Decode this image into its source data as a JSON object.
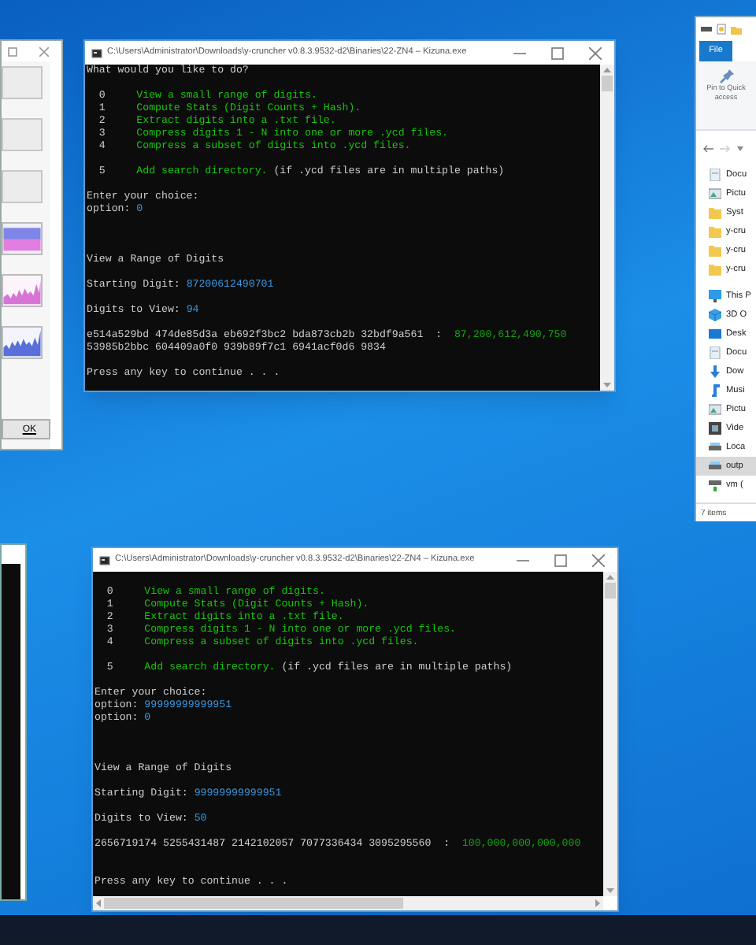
{
  "left_window": {
    "ok_button": "OK"
  },
  "consoles": [
    {
      "title": "C:\\Users\\Administrator\\Downloads\\y-cruncher v0.8.3.9532-d2\\Binaries\\22-ZN4 – Kizuna.exe",
      "horizontal_scrollbar": false,
      "lines": [
        {
          "kind": "text",
          "segments": [
            {
              "kind": "prompt",
              "text": "What would you like to do?"
            }
          ]
        },
        {
          "kind": "blank"
        },
        {
          "kind": "text",
          "segments": [
            {
              "kind": "prompt",
              "text": "  0     "
            },
            {
              "kind": "menu",
              "text": "View a small range of digits."
            }
          ]
        },
        {
          "kind": "text",
          "segments": [
            {
              "kind": "prompt",
              "text": "  1     "
            },
            {
              "kind": "menu",
              "text": "Compute Stats (Digit Counts + Hash)."
            }
          ]
        },
        {
          "kind": "text",
          "segments": [
            {
              "kind": "prompt",
              "text": "  2     "
            },
            {
              "kind": "menu",
              "text": "Extract digits into a .txt file."
            }
          ]
        },
        {
          "kind": "text",
          "segments": [
            {
              "kind": "prompt",
              "text": "  3     "
            },
            {
              "kind": "menu",
              "text": "Compress digits 1 - N into one or more .ycd files."
            }
          ]
        },
        {
          "kind": "text",
          "segments": [
            {
              "kind": "prompt",
              "text": "  4     "
            },
            {
              "kind": "menu",
              "text": "Compress a subset of digits into .ycd files."
            }
          ]
        },
        {
          "kind": "blank"
        },
        {
          "kind": "text",
          "segments": [
            {
              "kind": "prompt",
              "text": "  5     "
            },
            {
              "kind": "menu",
              "text": "Add search directory."
            },
            {
              "kind": "prompt",
              "text": " (if .ycd files are in multiple paths)"
            }
          ]
        },
        {
          "kind": "blank"
        },
        {
          "kind": "text",
          "segments": [
            {
              "kind": "prompt",
              "text": "Enter your choice:"
            }
          ]
        },
        {
          "kind": "text",
          "segments": [
            {
              "kind": "prompt",
              "text": "option: "
            },
            {
              "kind": "input",
              "text": "0"
            }
          ]
        },
        {
          "kind": "blank"
        },
        {
          "kind": "blank"
        },
        {
          "kind": "blank"
        },
        {
          "kind": "text",
          "segments": [
            {
              "kind": "prompt",
              "text": "View a Range of Digits"
            }
          ]
        },
        {
          "kind": "blank"
        },
        {
          "kind": "text",
          "segments": [
            {
              "kind": "prompt",
              "text": "Starting Digit: "
            },
            {
              "kind": "input",
              "text": "87200612490701"
            }
          ]
        },
        {
          "kind": "blank"
        },
        {
          "kind": "text",
          "segments": [
            {
              "kind": "prompt",
              "text": "Digits to View: "
            },
            {
              "kind": "input",
              "text": "94"
            }
          ]
        },
        {
          "kind": "blank"
        },
        {
          "kind": "text",
          "segments": [
            {
              "kind": "prompt",
              "text": "e514a529bd 474de85d3a eb692f3bc2 bda873cb2b 32bdf9a561  :  "
            },
            {
              "kind": "total",
              "text": "87,200,612,490,750"
            }
          ]
        },
        {
          "kind": "text",
          "segments": [
            {
              "kind": "prompt",
              "text": "53985b2bbc 604409a0f0 939b89f7c1 6941acf0d6 9834"
            }
          ]
        },
        {
          "kind": "blank"
        },
        {
          "kind": "text",
          "segments": [
            {
              "kind": "prompt",
              "text": "Press any key to continue . . ."
            }
          ]
        }
      ]
    },
    {
      "title": "C:\\Users\\Administrator\\Downloads\\y-cruncher v0.8.3.9532-d2\\Binaries\\22-ZN4 – Kizuna.exe",
      "horizontal_scrollbar": true,
      "lines": [
        {
          "kind": "text",
          "segments": [
            {
              "kind": "prompt",
              "text": "  0     "
            },
            {
              "kind": "menu",
              "text": "View a small range of digits."
            }
          ]
        },
        {
          "kind": "text",
          "segments": [
            {
              "kind": "prompt",
              "text": "  1     "
            },
            {
              "kind": "menu",
              "text": "Compute Stats (Digit Counts + Hash)."
            }
          ]
        },
        {
          "kind": "text",
          "segments": [
            {
              "kind": "prompt",
              "text": "  2     "
            },
            {
              "kind": "menu",
              "text": "Extract digits into a .txt file."
            }
          ]
        },
        {
          "kind": "text",
          "segments": [
            {
              "kind": "prompt",
              "text": "  3     "
            },
            {
              "kind": "menu",
              "text": "Compress digits 1 - N into one or more .ycd files."
            }
          ]
        },
        {
          "kind": "text",
          "segments": [
            {
              "kind": "prompt",
              "text": "  4     "
            },
            {
              "kind": "menu",
              "text": "Compress a subset of digits into .ycd files."
            }
          ]
        },
        {
          "kind": "blank"
        },
        {
          "kind": "text",
          "segments": [
            {
              "kind": "prompt",
              "text": "  5     "
            },
            {
              "kind": "menu",
              "text": "Add search directory."
            },
            {
              "kind": "prompt",
              "text": " (if .ycd files are in multiple paths)"
            }
          ]
        },
        {
          "kind": "blank"
        },
        {
          "kind": "text",
          "segments": [
            {
              "kind": "prompt",
              "text": "Enter your choice:"
            }
          ]
        },
        {
          "kind": "text",
          "segments": [
            {
              "kind": "prompt",
              "text": "option: "
            },
            {
              "kind": "input",
              "text": "99999999999951"
            }
          ]
        },
        {
          "kind": "text",
          "segments": [
            {
              "kind": "prompt",
              "text": "option: "
            },
            {
              "kind": "input",
              "text": "0"
            }
          ]
        },
        {
          "kind": "blank"
        },
        {
          "kind": "blank"
        },
        {
          "kind": "blank"
        },
        {
          "kind": "text",
          "segments": [
            {
              "kind": "prompt",
              "text": "View a Range of Digits"
            }
          ]
        },
        {
          "kind": "blank"
        },
        {
          "kind": "text",
          "segments": [
            {
              "kind": "prompt",
              "text": "Starting Digit: "
            },
            {
              "kind": "input",
              "text": "99999999999951"
            }
          ]
        },
        {
          "kind": "blank"
        },
        {
          "kind": "text",
          "segments": [
            {
              "kind": "prompt",
              "text": "Digits to View: "
            },
            {
              "kind": "input",
              "text": "50"
            }
          ]
        },
        {
          "kind": "blank"
        },
        {
          "kind": "text",
          "segments": [
            {
              "kind": "prompt",
              "text": "2656719174 5255431487 2142102057 7077336434 3095295560  :  "
            },
            {
              "kind": "total",
              "text": "100,000,000,000,000"
            }
          ]
        },
        {
          "kind": "blank"
        },
        {
          "kind": "blank"
        },
        {
          "kind": "text",
          "segments": [
            {
              "kind": "prompt",
              "text": "Press any key to continue . . ."
            }
          ]
        }
      ]
    }
  ],
  "explorer": {
    "file_tab": "File",
    "pin_label": "Pin to Quick access",
    "nav_items": [
      {
        "label": "Docu",
        "kind": "document",
        "selected": false
      },
      {
        "label": "Pictu",
        "kind": "pictures",
        "selected": false
      },
      {
        "label": "Syst",
        "kind": "folder",
        "selected": false
      },
      {
        "label": "y-cru",
        "kind": "folder",
        "selected": false
      },
      {
        "label": "y-cru",
        "kind": "folder",
        "selected": false
      },
      {
        "label": "y-cru",
        "kind": "folder",
        "selected": false
      },
      {
        "label": "This P",
        "kind": "computer",
        "selected": false
      },
      {
        "label": "3D O",
        "kind": "cube",
        "selected": false
      },
      {
        "label": "Desk",
        "kind": "desktop",
        "selected": false
      },
      {
        "label": "Docu",
        "kind": "document",
        "selected": false
      },
      {
        "label": "Dow",
        "kind": "download",
        "selected": false
      },
      {
        "label": "Musi",
        "kind": "music",
        "selected": false
      },
      {
        "label": "Pictu",
        "kind": "pictures",
        "selected": false
      },
      {
        "label": "Vide",
        "kind": "video",
        "selected": false
      },
      {
        "label": "Loca",
        "kind": "drive",
        "selected": false
      },
      {
        "label": "outp",
        "kind": "drive",
        "selected": true
      },
      {
        "label": "vm (",
        "kind": "network",
        "selected": false
      }
    ],
    "status": "7 items"
  }
}
